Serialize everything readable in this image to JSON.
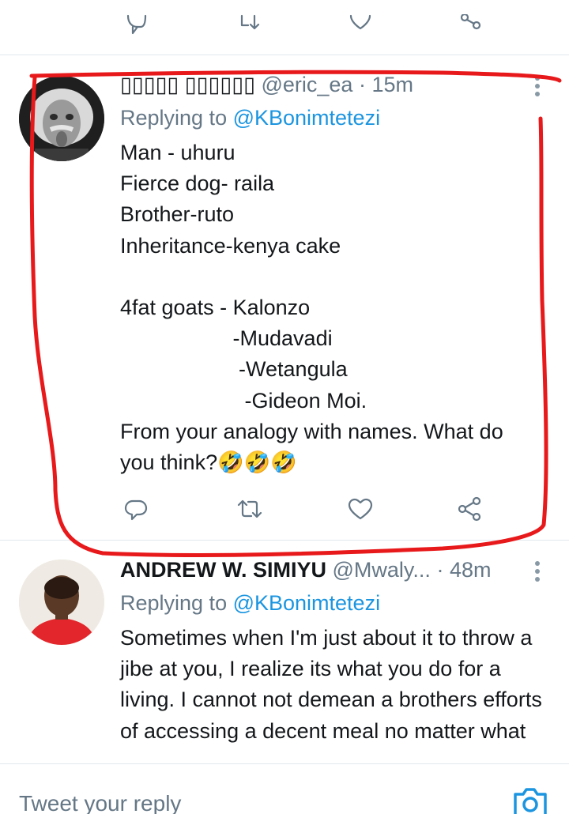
{
  "tweets": [
    {
      "name": "▯▯▯▯▯ ▯▯▯▯▯▯",
      "handle": "@eric_ea",
      "separator": " · ",
      "time": "15m",
      "replying_prefix": "Replying to ",
      "replying_to": "@KBonimtetezi",
      "body": "Man - uhuru\nFierce dog- raila\nBrother-ruto\nInheritance-kenya cake\n\n4fat goats - Kalonzo\n                   -Mudavadi\n                    -Wetangula\n                     -Gideon Moi.\nFrom your analogy with names. What do\nyou think?🤣🤣🤣",
      "avatar_icon": "einstein-photo-avatar"
    },
    {
      "name": "ANDREW W. SIMIYU",
      "handle": "@Mwaly...",
      "separator": " · ",
      "time": "48m",
      "replying_prefix": "Replying to ",
      "replying_to": "@KBonimtetezi",
      "body": "Sometimes when I'm just about it to throw a jibe at you, I realize its what you do for a living. I cannot not demean a brothers efforts of accessing a decent meal no matter what",
      "avatar_icon": "man-photo-avatar"
    }
  ],
  "actions": {
    "icons": [
      "reply-icon",
      "retweet-icon",
      "like-icon",
      "share-icon"
    ]
  },
  "composer": {
    "placeholder": "Tweet your reply",
    "camera_icon": "camera-icon"
  },
  "colors": {
    "accent": "#1b95e0",
    "muted": "#657786",
    "highlight": "#e8191b"
  }
}
